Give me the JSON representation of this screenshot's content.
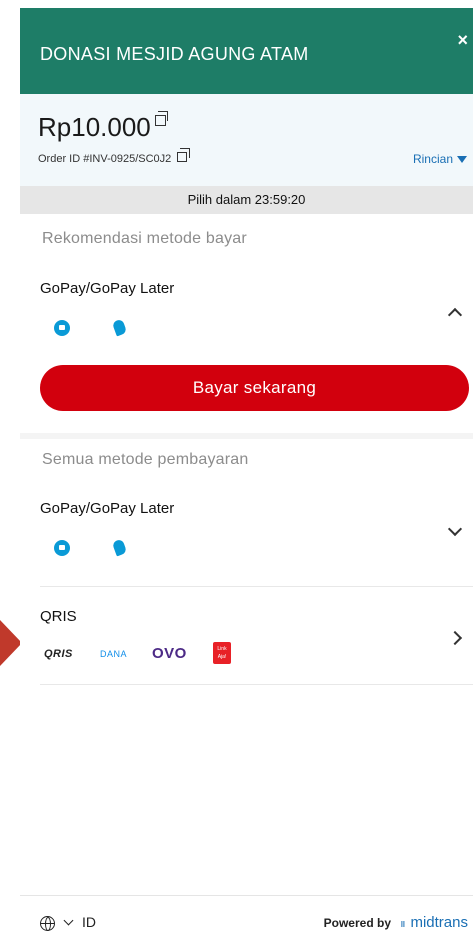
{
  "header": {
    "title": "DONASI MESJID AGUNG ATAM",
    "close_label": "×"
  },
  "summary": {
    "amount": "Rp10.000",
    "order_id": "Order ID #INV-0925/SC0J2",
    "details_label": "Rincian",
    "timer_text": "Pilih dalam  23:59:20"
  },
  "recommended": {
    "section_title": "Rekomendasi metode bayar",
    "method_name": "GoPay/GoPay Later",
    "pay_button": "Bayar sekarang"
  },
  "all_methods": {
    "section_title": "Semua metode pembayaran",
    "items": [
      {
        "name": "GoPay/GoPay Later"
      },
      {
        "name": "QRIS",
        "logos": [
          "QRIS",
          "DANA",
          "OVO",
          "Link Aja!"
        ]
      }
    ]
  },
  "footer": {
    "language": "ID",
    "powered_by": "Powered by",
    "brand": "midtrans"
  },
  "colors": {
    "header": "#1e7d67",
    "button": "#d2000d",
    "link": "#1a6fb4",
    "gopay": "#0a9ad6"
  },
  "icons": [
    "close-icon",
    "copy-icon",
    "caret-down-icon",
    "gopay-wallet-icon",
    "gopay-later-icon",
    "chevron-up-icon",
    "chevron-down-icon",
    "chevron-right-icon",
    "globe-icon",
    "pointer-arrow-icon"
  ]
}
